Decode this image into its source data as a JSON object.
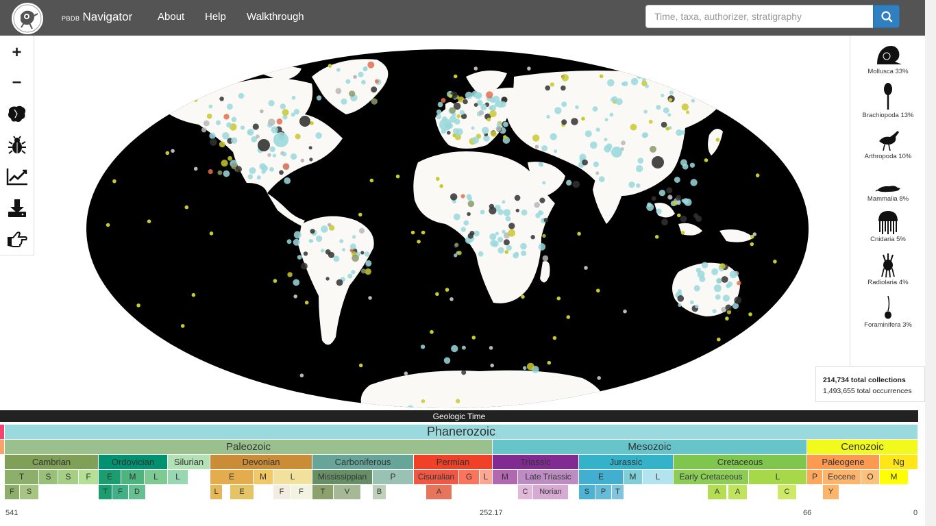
{
  "navbar": {
    "brand_small": "PBDB",
    "brand": "Navigator",
    "links": [
      "About",
      "Help",
      "Walkthrough"
    ],
    "search_placeholder": "Time, taxa, authorizer, stratigraphy"
  },
  "toolbar": {
    "zoom_in": "+",
    "zoom_out": "−",
    "icons": [
      "zoom-in-icon",
      "zoom-out-icon",
      "paleogeography-map-icon",
      "taxa-bug-icon",
      "diversity-chart-icon",
      "download-icon",
      "pointing-hand-icon"
    ]
  },
  "taxa": [
    {
      "label": "Mollusca 33%",
      "icon": "mollusca-icon"
    },
    {
      "label": "Brachiopoda 13%",
      "icon": "brachiopoda-icon"
    },
    {
      "label": "Arthropoda 10%",
      "icon": "arthropoda-icon"
    },
    {
      "label": "Mammalia 8%",
      "icon": "mammalia-icon"
    },
    {
      "label": "Cnidaria 5%",
      "icon": "cnidaria-icon"
    },
    {
      "label": "Radiolaria 4%",
      "icon": "radiolaria-icon"
    },
    {
      "label": "Foraminifera 3%",
      "icon": "foraminifera-icon"
    }
  ],
  "stats": {
    "collections": "214,734 total collections",
    "occurrences": "1,493,655 total occurrences"
  },
  "timescale": {
    "title": "Geologic Time",
    "eon": "Phanerozoic",
    "eras": [
      "Paleozoic",
      "Mesozoic",
      "Cenozoic"
    ],
    "periods": [
      "Cambrian",
      "Ordovician",
      "Silurian",
      "Devonian",
      "Carboniferous",
      "Permian",
      "Triassic",
      "Jurassic",
      "Cretaceous",
      "Paleogene",
      "Ng"
    ],
    "epochs": [
      "T",
      "S",
      "S",
      "F",
      "E",
      "M",
      "L",
      "L",
      "E",
      "M",
      "L",
      "Mississippian",
      "P",
      "Cisuralian",
      "G",
      "L",
      "M",
      "Late Triassic",
      "E",
      "M",
      "L",
      "Early Cretaceous",
      "L",
      "P",
      "Eocene",
      "O",
      "M"
    ],
    "ages": [
      "F",
      "S",
      "T",
      "F",
      "D",
      "L",
      "E",
      "F",
      "F",
      "T",
      "V",
      "B",
      "A",
      "C",
      "Norian",
      "S",
      "P",
      "T",
      "A",
      "A",
      "C",
      "Y"
    ],
    "ticks": [
      "541",
      "252.17",
      "66",
      "0"
    ],
    "colors": {
      "phanerozoic": "#9ad9dd",
      "paleozoic": "#99c08d",
      "mesozoic": "#67c5ca",
      "cenozoic": "#f2f91d"
    }
  },
  "map": {
    "ocean_color": "#000000",
    "land_color": "#fbf9f6",
    "dot_colors": [
      "#9ad9dd",
      "#333333",
      "#c9c930",
      "#8c9a6a",
      "#b8b8b8",
      "#e07050",
      "#9b7fb4"
    ]
  }
}
